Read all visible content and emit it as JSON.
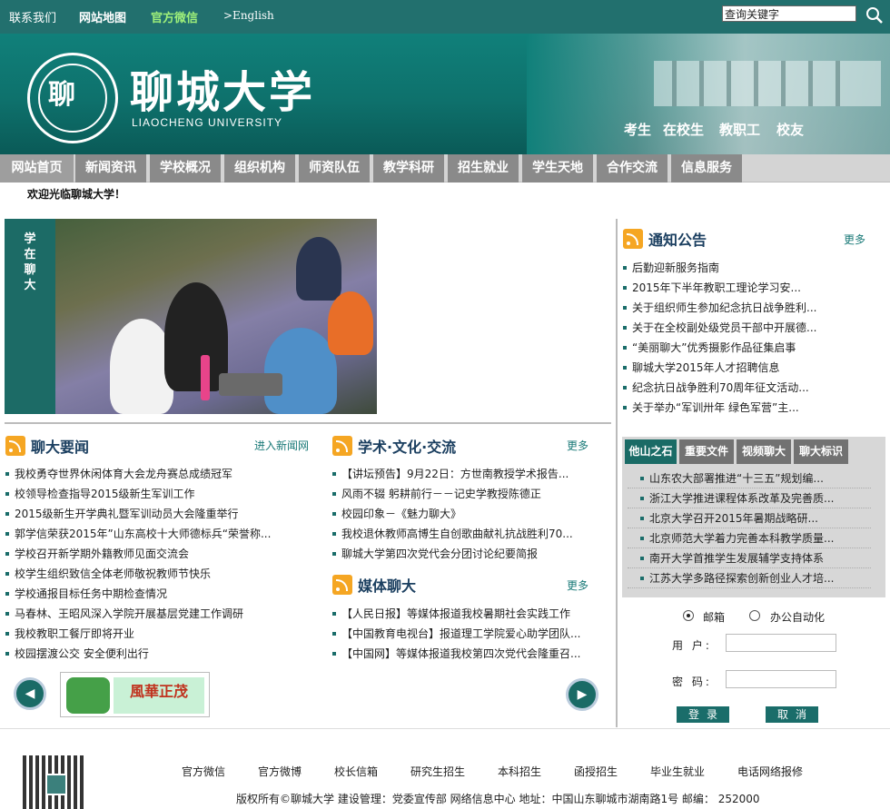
{
  "topbar": {
    "contact": "联系我们",
    "sitemap": "网站地图",
    "wechat": "官方微信",
    "english": ">English",
    "search_placeholder": "查询关键字"
  },
  "banner": {
    "logo_cn": "聊城大学",
    "logo_en": "LIAOCHENG UNIVERSITY",
    "links": [
      "考生",
      "在校生",
      "教职工",
      "校友"
    ]
  },
  "nav": [
    "网站首页",
    "新闻资讯",
    "学校概况",
    "组织机构",
    "师资队伍",
    "教学科研",
    "招生就业",
    "学生天地",
    "合作交流",
    "信息服务"
  ],
  "welcome": "欢迎光临聊城大学！",
  "photo": {
    "label": "学在聊大"
  },
  "notices": {
    "title": "通知公告",
    "more": "更多",
    "items": [
      "后勤迎新服务指南",
      "2015年下半年教职工理论学习安...",
      "关于组织师生参加纪念抗日战争胜利...",
      "关于在全校副处级党员干部中开展德...",
      "“美丽聊大”优秀摄影作品征集启事",
      "聊城大学2015年人才招聘信息",
      "纪念抗日战争胜利70周年征文活动...",
      "关于举办“军训卅年 绿色军营”主..."
    ]
  },
  "news": {
    "title": "聊大要闻",
    "more": "进入新闻网",
    "items": [
      "我校勇夺世界休闲体育大会龙舟赛总成绩冠军",
      "校领导检查指导2015级新生军训工作",
      "2015级新生开学典礼暨军训动员大会隆重举行",
      "郭学信荣获2015年”山东高校十大师德标兵“荣誉称...",
      "学校召开新学期外籍教师见面交流会",
      "校学生组织致信全体老师敬祝教师节快乐",
      "学校通报目标任务中期检查情况",
      "马春林、王昭风深入学院开展基层党建工作调研",
      "我校教职工餐厅即将开业",
      "校园摆渡公交 安全便利出行"
    ]
  },
  "academic": {
    "title": "学术·文化·交流",
    "more": "更多",
    "items": [
      "【讲坛预告】9月22日：方世南教授学术报告...",
      "风雨不辍 躬耕前行－－记史学教授陈德正",
      "校园印象－《魅力聊大》",
      "我校退休教师高博生自创歌曲献礼抗战胜利70...",
      "聊城大学第四次党代会分团讨论纪要简报"
    ]
  },
  "media": {
    "title": "媒体聊大",
    "more": "更多",
    "items": [
      "【人民日报】等媒体报道我校暑期社会实践工作",
      "【中国教育电视台】报道理工学院爱心助学团队...",
      "【中国网】等媒体报道我校第四次党代会隆重召..."
    ]
  },
  "tabs": {
    "labels": [
      "他山之石",
      "重要文件",
      "视频聊大",
      "聊大标识"
    ],
    "items": [
      "山东农大部署推进“十三五”规划编...",
      "浙江大学推进课程体系改革及完善质...",
      "北京大学召开2015年暑期战略研...",
      "北京师范大学着力完善本科教学质量...",
      "南开大学首推学生发展辅学支持体系",
      "江苏大学多路径探索创新创业人才培..."
    ]
  },
  "login": {
    "option_mail": "邮箱",
    "option_office": "办公自动化",
    "user_label": "用 户:",
    "pass_label": "密 码:",
    "login_btn": "登录",
    "cancel_btn": "取消"
  },
  "carousel": {
    "tile_text": "風華正茂"
  },
  "footer": {
    "links": [
      "官方微信",
      "官方微博",
      "校长信箱",
      "研究生招生",
      "本科招生",
      "函授招生",
      "毕业生就业",
      "电话网络报修"
    ],
    "copyright": "版权所有©聊城大学  建设管理：党委宣传部 网络信息中心  地址：中国山东聊城市湖南路1号  邮编： 252000"
  },
  "colors": {
    "brand_teal": "#22706e",
    "nav_gray": "#8a8a8a",
    "accent_orange": "#f5a623"
  }
}
